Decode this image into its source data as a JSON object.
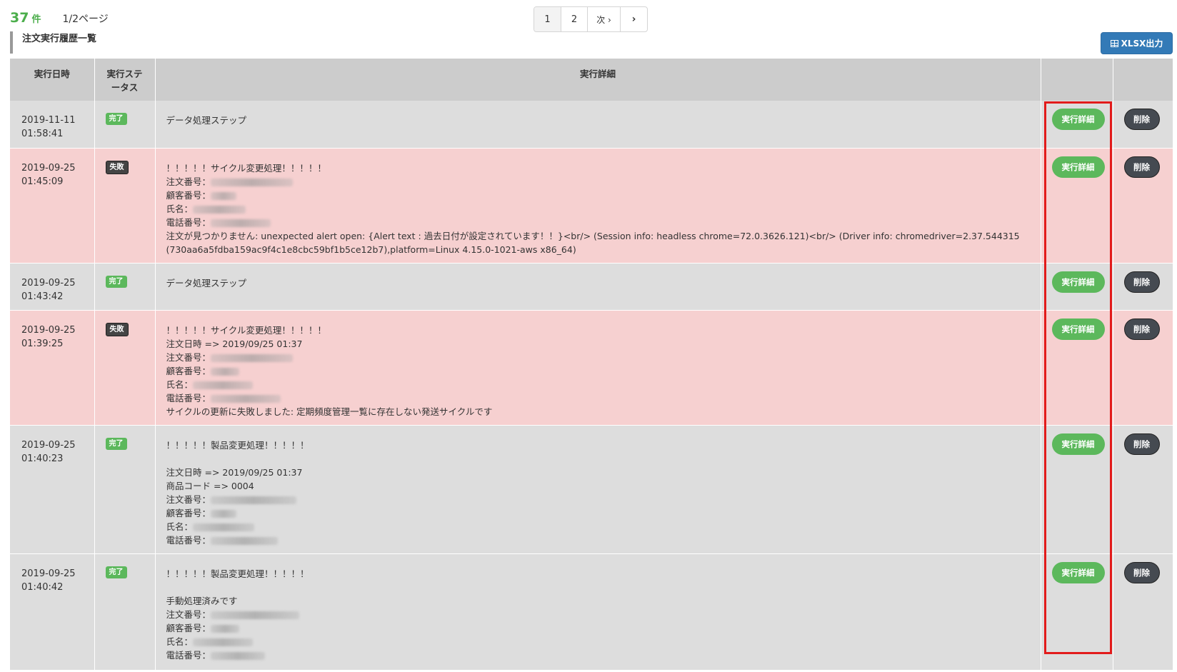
{
  "summary": {
    "count": "37",
    "count_unit": "件",
    "page_info": "1/2ページ"
  },
  "pagination": {
    "page1": "1",
    "page2": "2",
    "next": "次 ›",
    "arrow": "›"
  },
  "section_title": "注文実行履歴一覧",
  "export_button": "XLSX出力",
  "table": {
    "headers": {
      "date": "実行日時",
      "status_line1": "実行ステ",
      "status_line2": "ータス",
      "detail": "実行詳細"
    },
    "action_label": "実行詳細",
    "delete_label": "削除",
    "rows": [
      {
        "date1": "2019-11-11",
        "date2": "01:58:41",
        "status": "完了",
        "lines": [
          "データ処理ステップ"
        ]
      },
      {
        "date1": "2019-09-25",
        "date2": "01:45:09",
        "status": "失敗",
        "lines": [
          "！！！！！サイクル変更処理！！！！！",
          "注文番号：",
          "顧客番号：",
          "氏名：",
          "電話番号：",
          "注文が見つかりません: unexpected alert open: {Alert text : 過去日付が設定されています！！}<br/> (Session info: headless chrome=72.0.3626.121)<br/> (Driver info: chromedriver=2.37.544315",
          "(730aa6a5fdba159ac9f4c1e8cbc59bf1b5ce12b7),platform=Linux 4.15.0-1021-aws x86_64)"
        ]
      },
      {
        "date1": "2019-09-25",
        "date2": "01:43:42",
        "status": "完了",
        "lines": [
          "データ処理ステップ"
        ]
      },
      {
        "date1": "2019-09-25",
        "date2": "01:39:25",
        "status": "失敗",
        "lines": [
          "！！！！！サイクル変更処理！！！！！",
          "注文日時 => 2019/09/25 01:37",
          "注文番号：",
          "顧客番号：",
          "氏名：",
          "電話番号：",
          "サイクルの更新に失敗しました: 定期頻度管理一覧に存在しない発送サイクルです"
        ]
      },
      {
        "date1": "2019-09-25",
        "date2": "01:40:23",
        "status": "完了",
        "lines": [
          "！！！！！製品変更処理！！！！！",
          "",
          "注文日時 => 2019/09/25 01:37",
          "商品コード => 0004",
          "注文番号：",
          "顧客番号：",
          "氏名：",
          "電話番号："
        ]
      },
      {
        "date1": "2019-09-25",
        "date2": "01:40:42",
        "status": "完了",
        "lines": [
          "！！！！！製品変更処理！！！！！",
          "",
          "手動処理済みです",
          "注文番号：",
          "顧客番号：",
          "氏名：",
          "電話番号："
        ]
      }
    ]
  }
}
